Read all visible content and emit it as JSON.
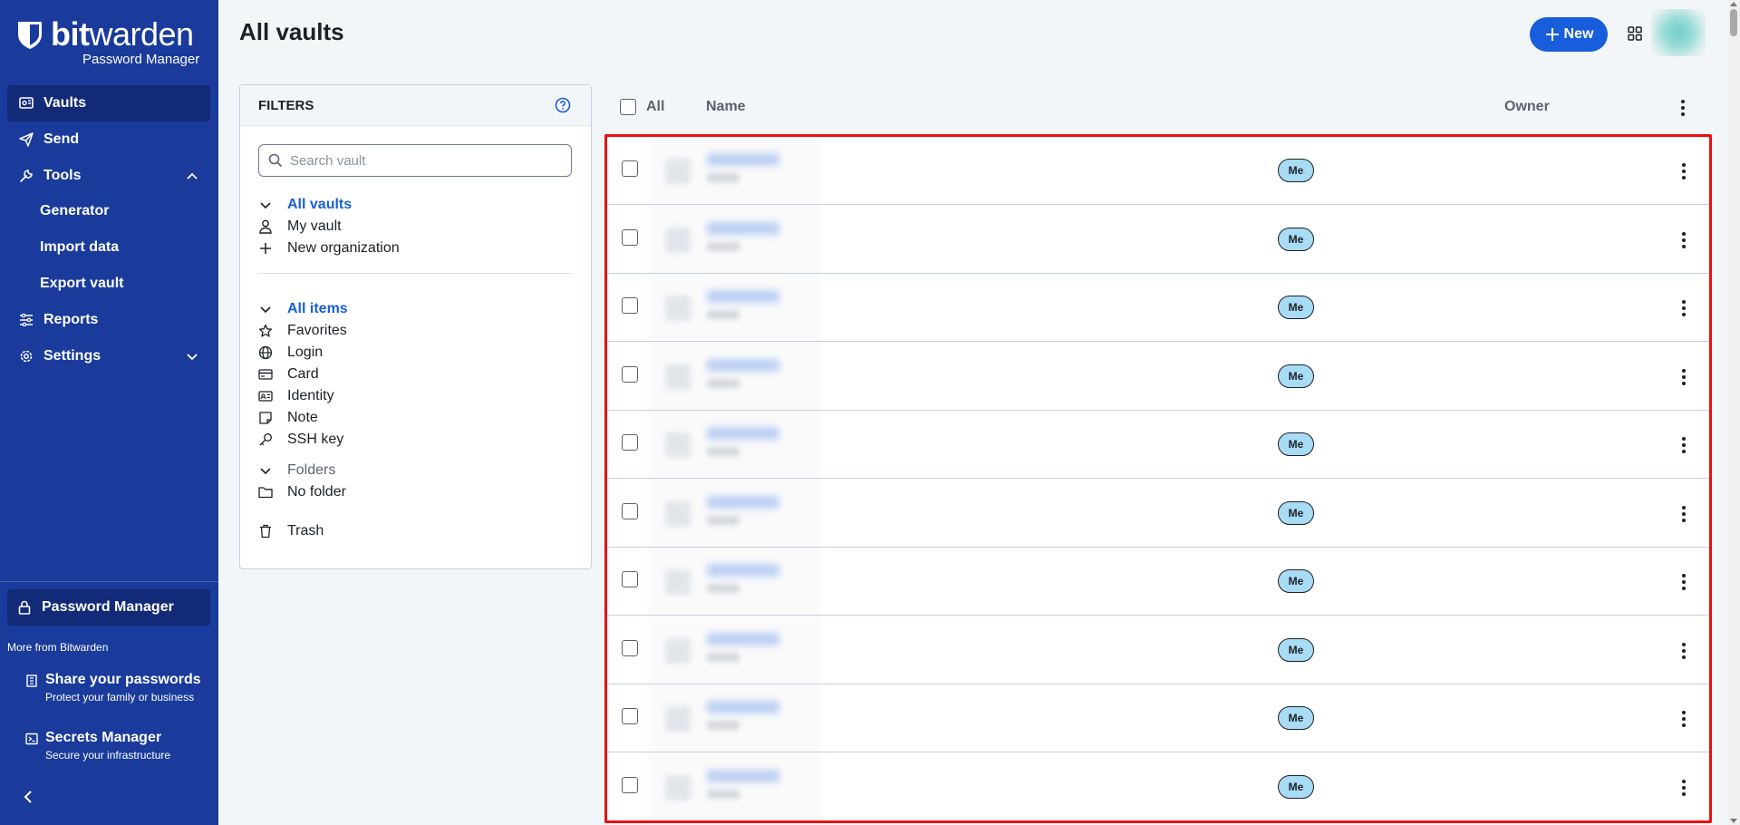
{
  "sidebar": {
    "brand_bold": "bit",
    "brand_rest": "warden",
    "subtitle": "Password Manager",
    "nav": {
      "vaults": "Vaults",
      "send": "Send",
      "tools": "Tools",
      "generator": "Generator",
      "import": "Import data",
      "export": "Export vault",
      "reports": "Reports",
      "settings": "Settings"
    },
    "product_active": "Password Manager",
    "more_label": "More from Bitwarden",
    "promos": [
      {
        "title": "Share your passwords",
        "desc": "Protect your family or business"
      },
      {
        "title": "Secrets Manager",
        "desc": "Secure your infrastructure"
      }
    ]
  },
  "header": {
    "title": "All vaults",
    "new_label": "New"
  },
  "filters": {
    "title": "FILTERS",
    "search_placeholder": "Search vault",
    "vaults": {
      "all": "All vaults",
      "my": "My vault",
      "new_org": "New organization"
    },
    "items": {
      "all": "All items",
      "favorites": "Favorites",
      "login": "Login",
      "card": "Card",
      "identity": "Identity",
      "note": "Note",
      "ssh": "SSH key"
    },
    "folders": {
      "label": "Folders",
      "none": "No folder"
    },
    "trash": "Trash"
  },
  "table": {
    "col_all": "All",
    "col_name": "Name",
    "col_owner": "Owner",
    "rows": [
      {
        "owner": "Me"
      },
      {
        "owner": "Me"
      },
      {
        "owner": "Me"
      },
      {
        "owner": "Me"
      },
      {
        "owner": "Me"
      },
      {
        "owner": "Me"
      },
      {
        "owner": "Me"
      },
      {
        "owner": "Me"
      },
      {
        "owner": "Me"
      },
      {
        "owner": "Me"
      }
    ]
  },
  "colors": {
    "sidebar_bg": "#1a3b9c",
    "accent": "#175ddc",
    "highlight_border": "#e81010",
    "owner_badge": "#a8dcf4"
  }
}
